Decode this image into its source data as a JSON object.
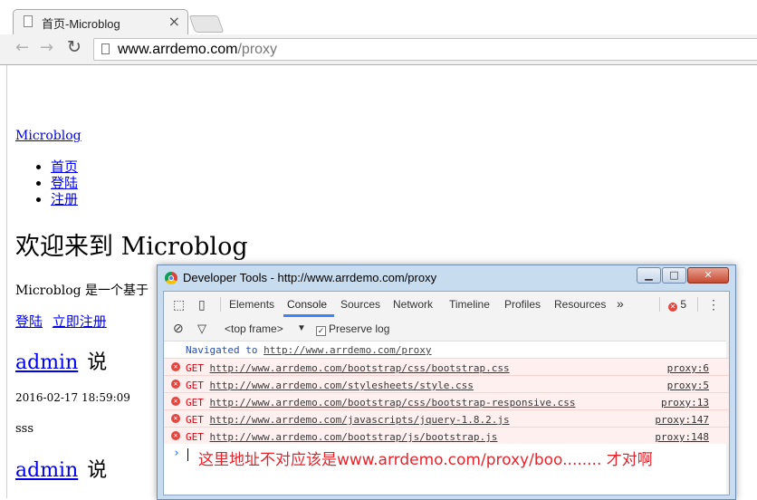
{
  "browser": {
    "tab_title": "首页-Microblog",
    "tab_close": "×",
    "url_host": "www.arrdemo.com",
    "url_path": "/proxy"
  },
  "page": {
    "brand": "Microblog",
    "nav": [
      "首页",
      "登陆",
      "注册"
    ],
    "heading": "欢迎来到 Microblog",
    "description": "Microblog 是一个基于",
    "links": [
      "登陆",
      "立即注册"
    ],
    "posts": [
      {
        "author": "admin",
        "says": "说",
        "time": "2016-02-17 18:59:09",
        "text": "sss"
      },
      {
        "author": "admin",
        "says": "说"
      }
    ]
  },
  "devtools": {
    "title": "Developer Tools - http://www.arrdemo.com/proxy",
    "tabs": [
      "Elements",
      "Console",
      "Sources",
      "Network",
      "Timeline",
      "Profiles",
      "Resources"
    ],
    "active_tab": "Console",
    "more_tabs": "»",
    "error_count": "5",
    "filter_frame": "<top frame>",
    "preserve_log": "Preserve log",
    "console": [
      {
        "type": "info",
        "prefix": "Navigated to ",
        "url": "http://www.arrdemo.com/proxy",
        "src": ""
      },
      {
        "type": "error",
        "prefix": "GET ",
        "url": "http://www.arrdemo.com/bootstrap/css/bootstrap.css",
        "src": "proxy:6"
      },
      {
        "type": "error",
        "prefix": "GET ",
        "url": "http://www.arrdemo.com/stylesheets/style.css",
        "src": "proxy:5"
      },
      {
        "type": "error",
        "prefix": "GET ",
        "url": "http://www.arrdemo.com/bootstrap/css/bootstrap-responsive.css",
        "src": "proxy:13"
      },
      {
        "type": "error",
        "prefix": "GET ",
        "url": "http://www.arrdemo.com/javascripts/jquery-1.8.2.js",
        "src": "proxy:147"
      },
      {
        "type": "error",
        "prefix": "GET ",
        "url": "http://www.arrdemo.com/bootstrap/js/bootstrap.js",
        "src": "proxy:148"
      }
    ],
    "annotation": "这里地址不对应该是www.arrdemo.com/proxy/boo........ 才对啊"
  },
  "colors": {
    "error": "#e2463f",
    "link": "#0000ee",
    "annotation": "#e8222a",
    "active_tab": "#3e82f7"
  }
}
